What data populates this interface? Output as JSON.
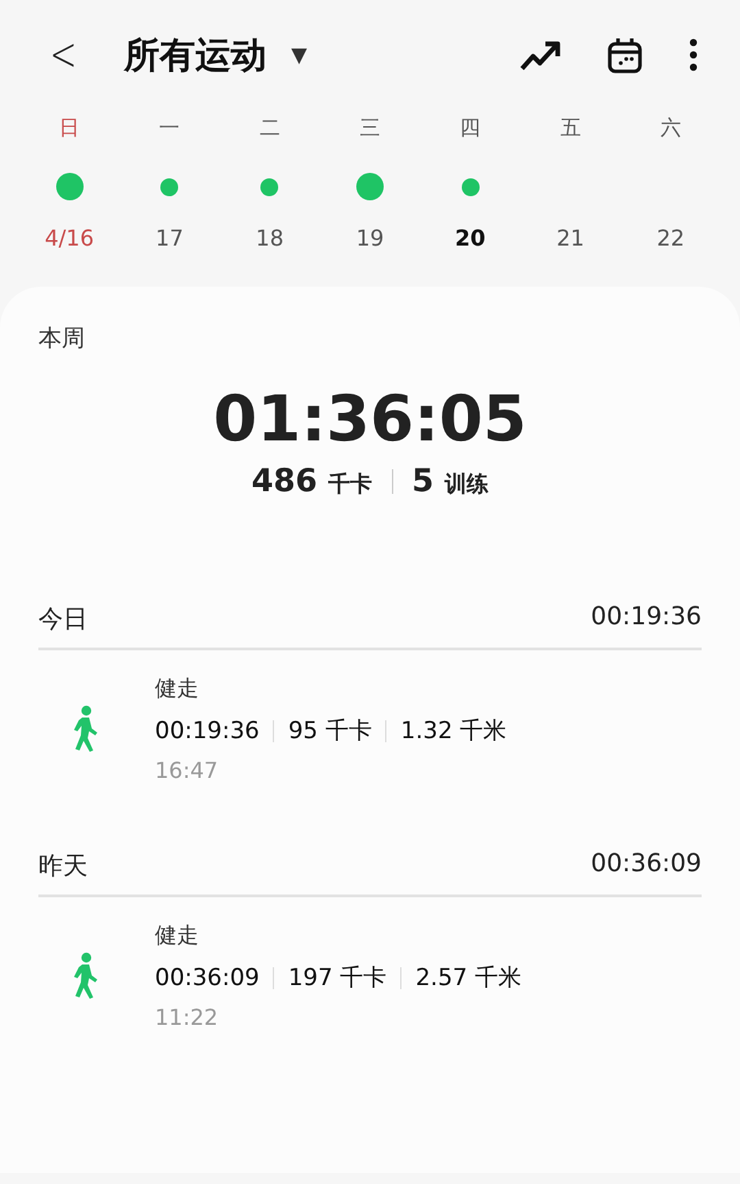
{
  "header": {
    "back": "<",
    "title": "所有运动",
    "dropdown": "▼"
  },
  "week": [
    {
      "weekday": "日",
      "date": "4/16",
      "sunday": true,
      "today": false,
      "active": true,
      "goal_met": true
    },
    {
      "weekday": "一",
      "date": "17",
      "sunday": false,
      "today": false,
      "active": true,
      "goal_met": false
    },
    {
      "weekday": "二",
      "date": "18",
      "sunday": false,
      "today": false,
      "active": true,
      "goal_met": false
    },
    {
      "weekday": "三",
      "date": "19",
      "sunday": false,
      "today": false,
      "active": true,
      "goal_met": true
    },
    {
      "weekday": "四",
      "date": "20",
      "sunday": false,
      "today": true,
      "active": true,
      "goal_met": false
    },
    {
      "weekday": "五",
      "date": "21",
      "sunday": false,
      "today": false,
      "active": false
    },
    {
      "weekday": "六",
      "date": "22",
      "sunday": false,
      "today": false,
      "active": false
    }
  ],
  "summary": {
    "label": "本周",
    "duration": "01:36:05",
    "stats": [
      {
        "value": "486",
        "unit": "千卡"
      },
      {
        "value": "5",
        "unit": "训练"
      }
    ]
  },
  "days": [
    {
      "label": "今日",
      "total": "00:19:36",
      "activities": [
        {
          "name": "健走",
          "metrics": [
            "00:19:36",
            "95 千卡",
            "1.32 千米"
          ],
          "time": "16:47"
        }
      ]
    },
    {
      "label": "昨天",
      "total": "00:36:09",
      "activities": [
        {
          "name": "健走",
          "metrics": [
            "00:36:09",
            "197 千卡",
            "2.57 千米"
          ],
          "time": "11:22"
        }
      ]
    }
  ]
}
